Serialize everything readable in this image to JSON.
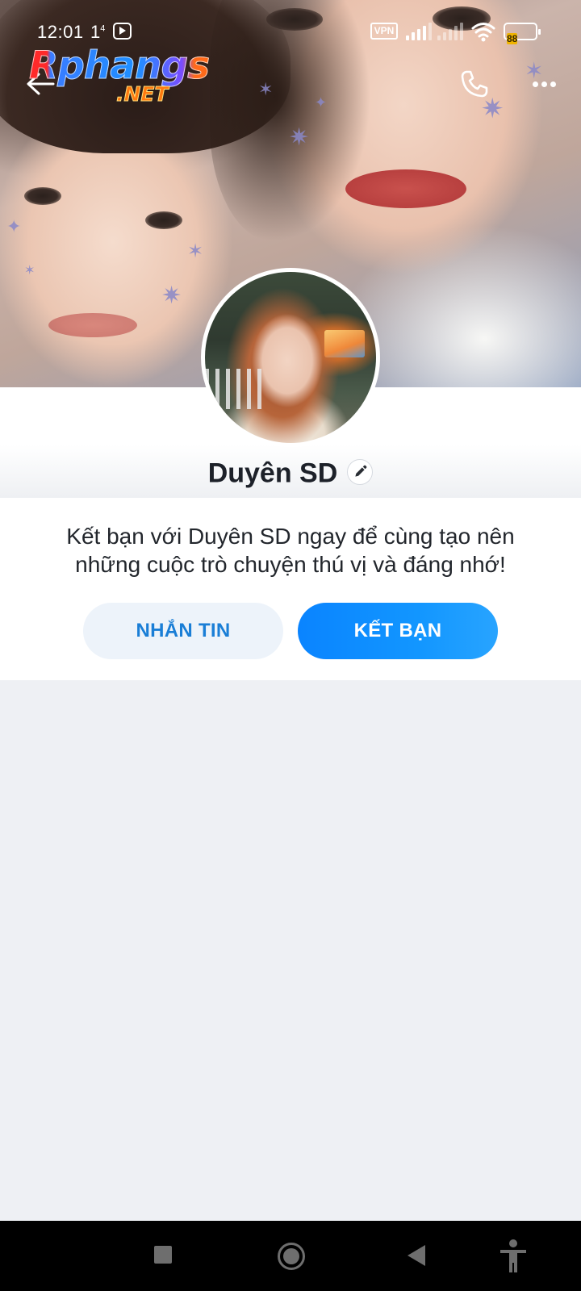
{
  "status_bar": {
    "time": "12:01",
    "extra": "1",
    "extra_sup": "4",
    "vpn": "VPN",
    "battery": "88"
  },
  "watermark": {
    "main": "Rphangs",
    "suffix": ".NET"
  },
  "header": {
    "back_icon": "arrow-left-icon",
    "call_icon": "phone-icon",
    "more_icon": "more-dots-icon"
  },
  "profile": {
    "name": "Duyên SD",
    "edit_icon": "pencil-icon"
  },
  "prompt": {
    "text": "Kết bạn với Duyên SD ngay để cùng tạo nên những cuộc trò chuyện thú vị và đáng nhớ!",
    "message_button": "NHẮN TIN",
    "add_friend_button": "KẾT BẠN"
  },
  "colors": {
    "accent": "#0A84FF",
    "message_button_bg": "#EDF3FA",
    "page_bg": "#EEF0F4",
    "nav_bar": "#000000"
  },
  "nav_bar": {
    "icons": [
      "recents-square-icon",
      "home-circle-icon",
      "back-triangle-icon",
      "accessibility-icon"
    ]
  }
}
